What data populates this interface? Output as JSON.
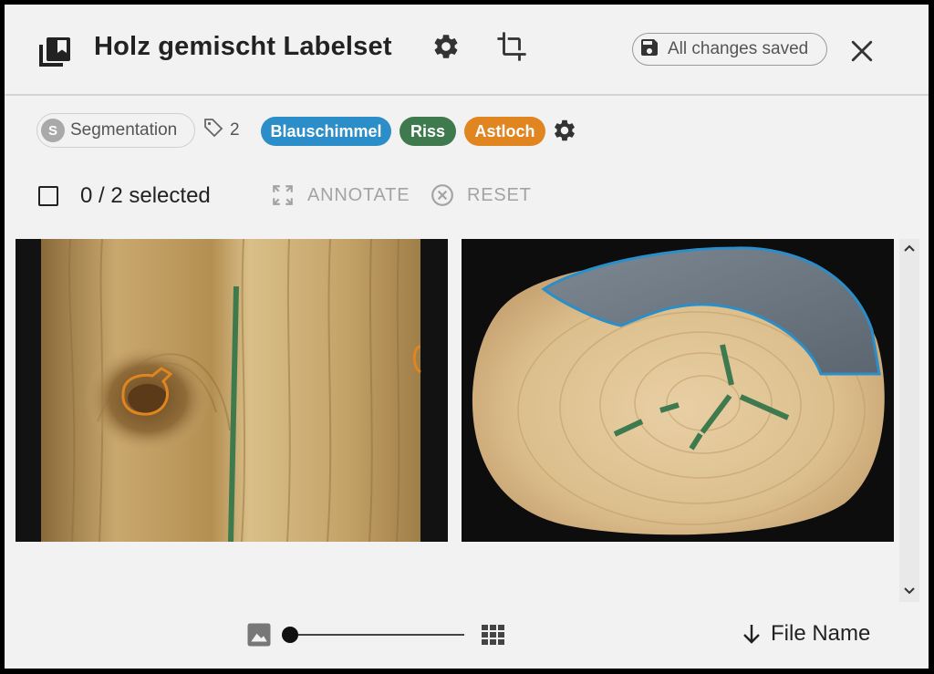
{
  "header": {
    "title": "Holz gemischt Labelset",
    "save_status": "All changes saved",
    "icons": [
      "library-icon",
      "gear-icon",
      "crop-icon",
      "save-icon",
      "close-icon"
    ]
  },
  "toolbar": {
    "mode_letter": "S",
    "mode_label": "Segmentation",
    "tag_count": "2",
    "labels": [
      {
        "name": "Blauschimmel",
        "color": "#2b8ec9"
      },
      {
        "name": "Riss",
        "color": "#3f7a4f"
      },
      {
        "name": "Astloch",
        "color": "#e0851f"
      }
    ]
  },
  "selection": {
    "text": "0 / 2 selected",
    "annotate_label": "ANNOTATE",
    "reset_label": "RESET"
  },
  "images": [
    {
      "name": "wood-board-image",
      "annotations": [
        "Astloch",
        "Riss",
        "Astloch"
      ]
    },
    {
      "name": "log-cross-section-image",
      "annotations": [
        "Blauschimmel",
        "Riss",
        "Riss",
        "Riss",
        "Riss",
        "Riss",
        "Riss"
      ]
    }
  ],
  "footer": {
    "sort_label": "File Name",
    "zoom_level": 0
  }
}
